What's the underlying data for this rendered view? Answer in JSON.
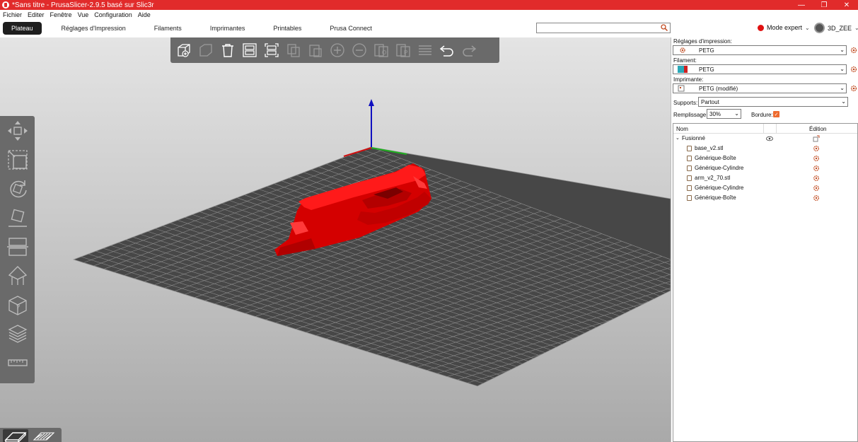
{
  "window": {
    "title": "*Sans titre - PrusaSlicer-2.9.5 basé sur Slic3r",
    "minimize": "—",
    "maximize": "❐",
    "close": "✕"
  },
  "menu": [
    "Fichier",
    "Editer",
    "Fenêtre",
    "Vue",
    "Configuration",
    "Aide"
  ],
  "tabs": [
    {
      "label": "Plateau",
      "active": true
    },
    {
      "label": "Réglages d'Impression",
      "active": false
    },
    {
      "label": "Filaments",
      "active": false
    },
    {
      "label": "Imprimantes",
      "active": false
    },
    {
      "label": "Printables",
      "active": false
    },
    {
      "label": "Prusa Connect",
      "active": false
    }
  ],
  "search": {
    "placeholder": "",
    "icon": "search-icon"
  },
  "mode": {
    "label": "Mode expert",
    "color": "#e01010"
  },
  "user": {
    "name": "3D_ZEE"
  },
  "panel": {
    "print_settings_label": "Réglages d'impression:",
    "print_settings_value": "PETG",
    "filament_label": "Filament:",
    "filament_value": "PETG",
    "printer_label": "Imprimante:",
    "printer_value": "PETG (modifié)",
    "supports_label": "Supports:",
    "supports_value": "Partout",
    "infill_label": "Remplissage:",
    "infill_value": "30%",
    "brim_label": "Bordure:",
    "brim_checked": true,
    "tree": {
      "col_name": "Nom",
      "col_edit": "Édition",
      "root": "Fusionné",
      "items": [
        "base_v2.stl",
        "Générique-Boîte",
        "Générique-Cylindre",
        "arm_v2_70.stl",
        "Générique-Cylindre",
        "Générique-Boîte"
      ]
    }
  },
  "colors": {
    "accent": "#e12b2b",
    "active_tab": "#1e1e1e",
    "brim_check": "#ee6b2f",
    "model": "#e00000"
  }
}
